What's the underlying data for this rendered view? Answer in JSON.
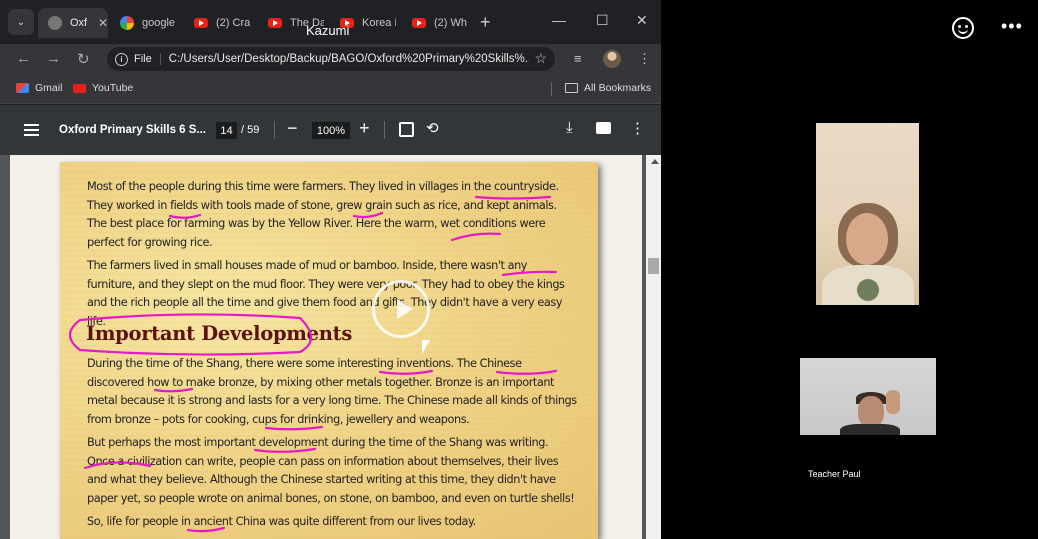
{
  "browser": {
    "tabs": [
      {
        "label": "Oxf",
        "favicon": "globe-icon",
        "active": true
      },
      {
        "label": "google",
        "favicon": "google-icon",
        "active": false
      },
      {
        "label": "(2) Cra",
        "favicon": "youtube-icon",
        "active": false
      },
      {
        "label": "The Da",
        "favicon": "youtube-icon",
        "active": false
      },
      {
        "label": "Korea I",
        "favicon": "youtube-icon",
        "active": false
      },
      {
        "label": "(2) Wh",
        "favicon": "youtube-icon",
        "active": false
      }
    ],
    "new_tab": "+",
    "window_controls": {
      "minimize": "—",
      "maximize": "☐",
      "close": "✕"
    },
    "address": {
      "chip": "File",
      "url": "C:/Users/User/Desktop/Backup/BAGO/Oxford%20Primary%20Skills%..."
    },
    "bookmarks": [
      {
        "label": "Gmail",
        "icon": "gmail-icon"
      },
      {
        "label": "YouTube",
        "icon": "youtube-icon"
      }
    ],
    "all_bookmarks": "All Bookmarks"
  },
  "sharer_name": "Kazumi",
  "pdf": {
    "title": "Oxford Primary Skills 6 S...",
    "page_current": "14",
    "page_total": "/ 59",
    "zoom": "100%",
    "paragraphs": [
      "Most of the people during this time were farmers. They lived in villages in the countryside. They worked in fields with tools made of stone, grew grain such as rice, and kept animals. The best place for farming was by the Yellow River. Here the warm, wet conditions were perfect for growing rice.",
      "The farmers lived in small houses made of mud or bamboo. Inside, there wasn't any furniture, and they slept on the mud floor. They were very poor. They had to obey the kings and the rich people all the time and give them food and gifts. They didn't have a very easy life.",
      "During the time of the Shang, there were some interesting inventions. The Chinese discovered how to make bronze, by mixing other metals together. Bronze is an important metal because it is strong and lasts for a very long time. The Chinese made all kinds of things from bronze – pots for cooking, cups for drinking, jewellery and weapons.",
      "But perhaps the most important development during the time of the Shang was writing. Once a civilization can write, people can pass on information about themselves, their lives and what they believe. Although the Chinese started writing at this time, they didn't have paper yet, so people wrote on animal bones, on stone, on bamboo, and even on turtle shells!",
      "So, life for people in ancient China was quite different from our lives today."
    ],
    "heading": "Important Developments",
    "annotation_color": "#e619c8"
  },
  "meeting": {
    "participant_name": "Teacher Paul"
  }
}
